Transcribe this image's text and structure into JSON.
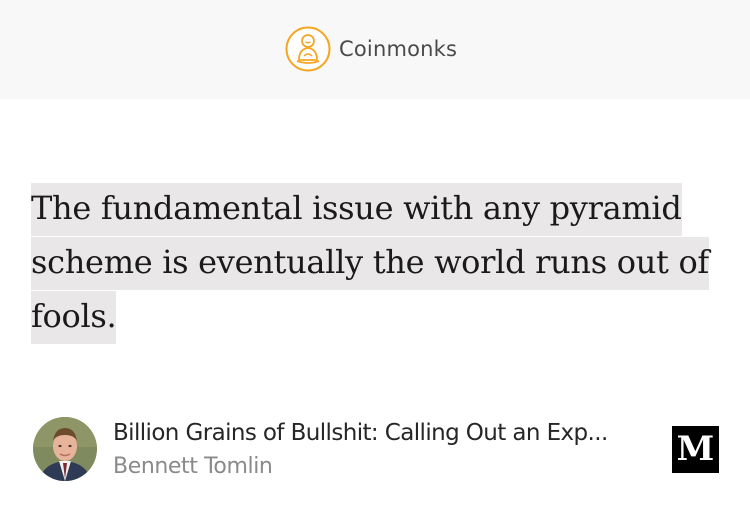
{
  "header": {
    "publication_name": "Coinmonks",
    "logo_icon": "monk-icon",
    "logo_color": "#f5a623"
  },
  "quote": {
    "text": "The fundamental issue with any pyramid scheme is eventually the world runs out of fools.",
    "highlight_color": "#e9e7e8"
  },
  "link_card": {
    "title": "Billion Grains of Bullshit: Calling Out an Exp...",
    "author": "Bennett Tomlin",
    "source_logo_letter": "M",
    "source_icon": "medium-logo-icon"
  }
}
